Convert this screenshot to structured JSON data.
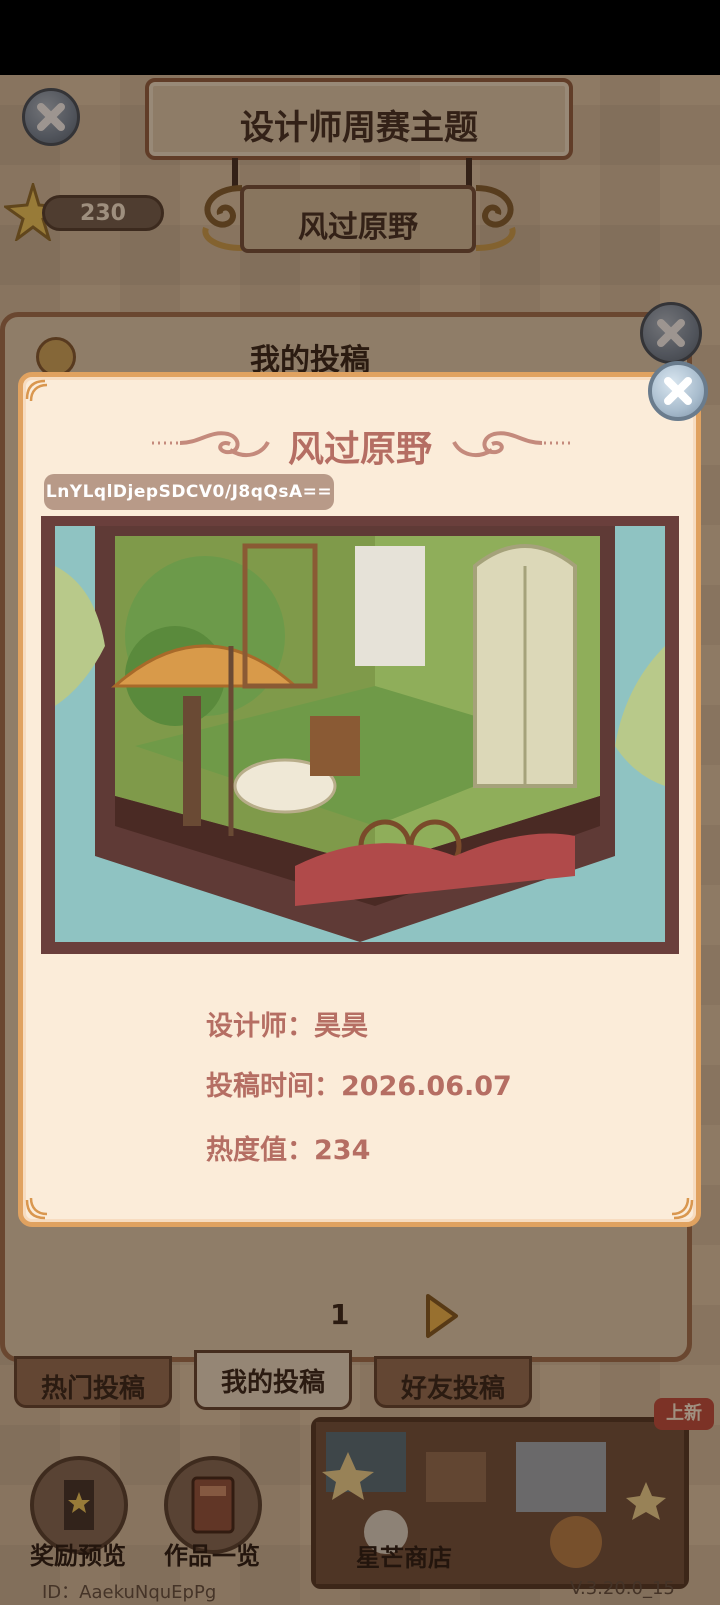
{
  "header": {
    "title": "设计师周赛主题",
    "theme_name": "风过原野",
    "star_count": "230"
  },
  "panel": {
    "title": "我的投稿",
    "page_number": "1",
    "tabs": [
      {
        "label": "热门投稿",
        "active": false
      },
      {
        "label": "我的投稿",
        "active": true
      },
      {
        "label": "好友投稿",
        "active": false
      }
    ]
  },
  "bottom": {
    "rewards_label": "奖励预览",
    "works_label": "作品一览",
    "shop_label": "星芒商店",
    "new_badge": "上新",
    "player_id": "ID：AaekuNquEpPg",
    "version": "V.3.20.0_15"
  },
  "modal": {
    "title": "风过原野",
    "share_code": "LnYLqlDjepSDCV0/J8qQsA==",
    "designer_line": "设计师：昊昊",
    "submit_time_line": "投稿时间：2026.06.07",
    "heat_line": "热度值：234"
  },
  "colors": {
    "modal_bg": "#fbecd9",
    "modal_border": "#e0a260",
    "accent_text": "#b56e63",
    "scene_frame": "#6a3f3c"
  }
}
